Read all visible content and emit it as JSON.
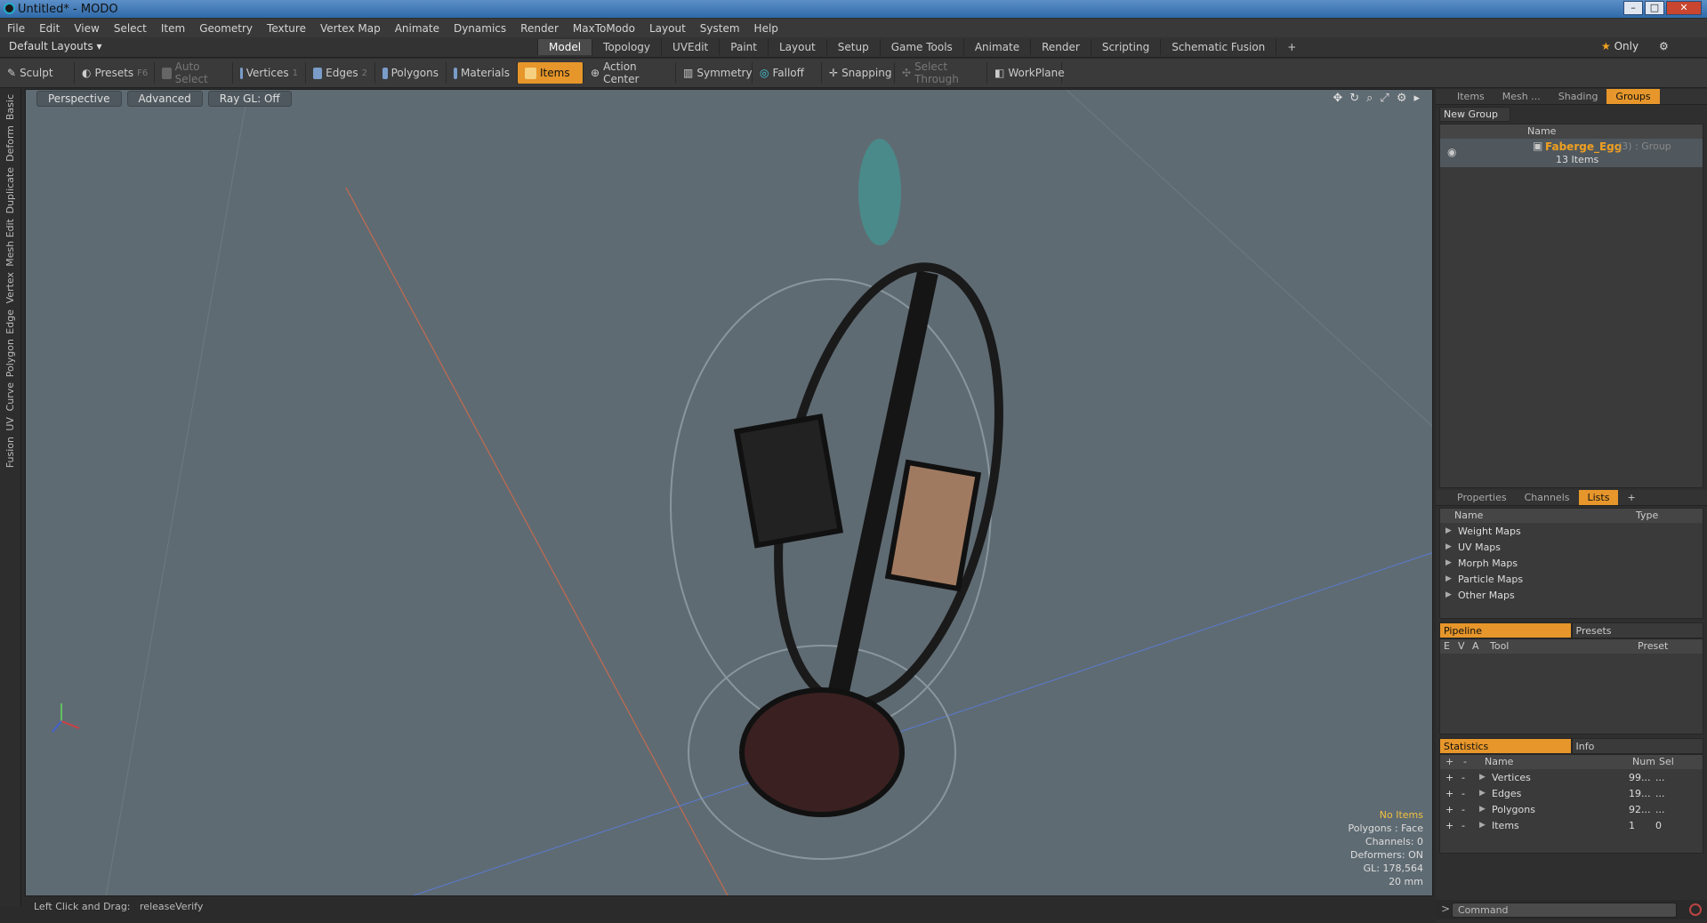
{
  "window": {
    "title": "Untitled* - MODO"
  },
  "menu": [
    "File",
    "Edit",
    "View",
    "Select",
    "Item",
    "Geometry",
    "Texture",
    "Vertex Map",
    "Animate",
    "Dynamics",
    "Render",
    "MaxToModo",
    "Layout",
    "System",
    "Help"
  ],
  "layout": {
    "name": "Default Layouts ▾",
    "tabs": [
      "Model",
      "Topology",
      "UVEdit",
      "Paint",
      "Layout",
      "Setup",
      "Game Tools",
      "Animate",
      "Render",
      "Scripting",
      "Schematic Fusion",
      "+"
    ],
    "active_tab": "Model",
    "only_label": "Only"
  },
  "toolbar": {
    "sculpt": "Sculpt",
    "presets": "Presets",
    "presets_key": "F6",
    "auto_select": "Auto Select",
    "vertices": "Vertices",
    "vertices_num": "1",
    "edges": "Edges",
    "edges_num": "2",
    "polygons": "Polygons",
    "materials": "Materials",
    "items": "Items",
    "action_center": "Action Center",
    "symmetry": "Symmetry",
    "falloff": "Falloff",
    "snapping": "Snapping",
    "select_through": "Select Through",
    "workplane": "WorkPlane"
  },
  "left_tabs": [
    "Basic",
    "Deform",
    "Duplicate",
    "Mesh Edit",
    "Vertex",
    "Edge",
    "Polygon",
    "Curve",
    "UV",
    "Fusion"
  ],
  "viewport": {
    "perspective": "Perspective",
    "advanced": "Advanced",
    "raygl": "Ray GL: Off",
    "info": {
      "no_items": "No Items",
      "polygons": "Polygons : Face",
      "channels": "Channels: 0",
      "deformers": "Deformers: ON",
      "gl": "GL: 178,564",
      "scale": "20 mm"
    }
  },
  "status": {
    "hint": "Left Click and Drag:",
    "action": "releaseVerify"
  },
  "right": {
    "top_tabs": [
      "Items",
      "Mesh ...",
      "Shading",
      "Groups"
    ],
    "active_top_tab": "Groups",
    "new_group": "New Group",
    "groups_header": "Name",
    "group": {
      "name": "Faberge_Egg",
      "type": "(3) : Group",
      "count": "13 Items"
    },
    "mid_tabs": [
      "Properties",
      "Channels",
      "Lists",
      "+"
    ],
    "active_mid_tab": "Lists",
    "lists_header": {
      "name": "Name",
      "type": "Type"
    },
    "lists": [
      "Weight Maps",
      "UV Maps",
      "Morph Maps",
      "Particle Maps",
      "Other Maps"
    ],
    "pipeline_tabs": [
      "Pipeline",
      "Presets"
    ],
    "pipeline_header": {
      "e": "E",
      "v": "V",
      "a": "A",
      "tool": "Tool",
      "preset": "Preset"
    },
    "stats_tabs": [
      "Statistics",
      "Info"
    ],
    "stats_header": {
      "plus": "+",
      "minus": "-",
      "name": "Name",
      "num": "Num",
      "sel": "Sel"
    },
    "stats": [
      {
        "name": "Vertices",
        "num": "99...",
        "sel": "..."
      },
      {
        "name": "Edges",
        "num": "19...",
        "sel": "..."
      },
      {
        "name": "Polygons",
        "num": "92...",
        "sel": "..."
      },
      {
        "name": "Items",
        "num": "1",
        "sel": "0"
      }
    ],
    "command_placeholder": "Command"
  },
  "colors": {
    "accent": "#e6962a",
    "viewport_bg": "#5f6b73",
    "group_name": "#f0a020"
  }
}
